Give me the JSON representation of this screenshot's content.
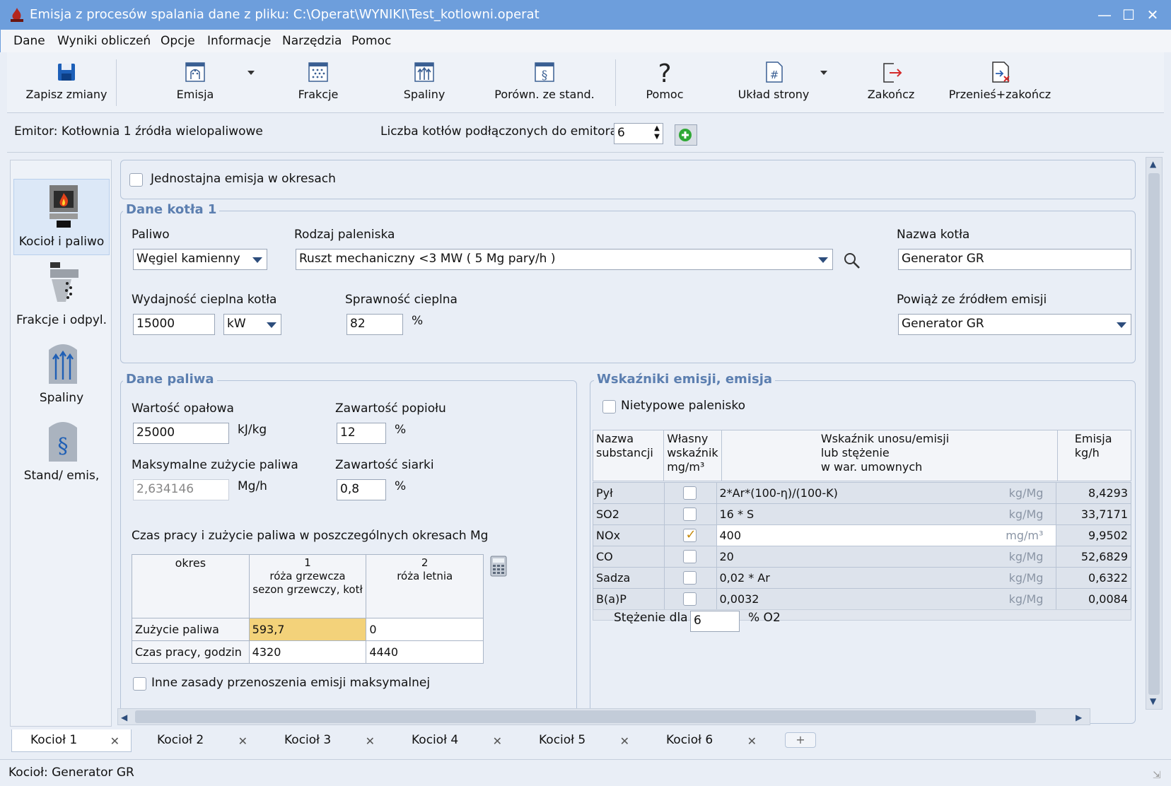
{
  "window": {
    "title": "Emisja z procesów spalania   dane z pliku: C:\\Operat\\WYNIKI\\Test_kotlowni.operat"
  },
  "menu": [
    "Dane",
    "Wyniki obliczeń",
    "Opcje",
    "Informacje",
    "Narzędzia",
    "Pomoc"
  ],
  "toolbar": {
    "save": "Zapisz zmiany",
    "emisja": "Emisja",
    "frakcje": "Frakcje",
    "spaliny": "Spaliny",
    "porown": "Porówn. ze stand.",
    "pomoc": "Pomoc",
    "uklad": "Układ strony",
    "zakoncz": "Zakończ",
    "przenies": "Przenieś+zakończ"
  },
  "emitter": {
    "label": "Emitor: Kotłownia 1 źródła wielopaliwowe",
    "boilers_label": "Liczba kotłów podłączonych do emitora",
    "boilers_value": "6"
  },
  "nav": [
    "Kocioł i paliwo",
    "Frakcje i odpyl.",
    "Spaliny",
    "Stand/ emis,"
  ],
  "uniform_emission": "Jednostajna emisja w okresach",
  "boiler": {
    "group_title": "Dane kotła 1",
    "fuel_label": "Paliwo",
    "fuel_value": "Węgiel kamienny",
    "furnace_label": "Rodzaj paleniska",
    "furnace_value": "Ruszt mechaniczny <3 MW ( 5 Mg pary/h )",
    "name_label": "Nazwa kotła",
    "name_value": "Generator GR",
    "capacity_label": "Wydajność cieplna kotła",
    "capacity_value": "15000",
    "capacity_unit": "kW",
    "efficiency_label": "Sprawność cieplna",
    "efficiency_value": "82",
    "efficiency_unit": "%",
    "link_label": "Powiąż ze źródłem emisji",
    "link_value": "Generator GR"
  },
  "fuel": {
    "group_title": "Dane paliwa",
    "calorific_label": "Wartość opałowa",
    "calorific_value": "25000",
    "calorific_unit": "kJ/kg",
    "ash_label": "Zawartość popiołu",
    "ash_value": "12",
    "ash_unit": "%",
    "max_use_label": "Maksymalne zużycie paliwa",
    "max_use_value": "2,634146",
    "max_use_unit": "Mg/h",
    "sulfur_label": "Zawartość siarki",
    "sulfur_value": "0,8",
    "sulfur_unit": "%",
    "periods_label": "Czas pracy i zużycie paliwa w poszczególnych okresach Mg",
    "periods_header": {
      "okres": "okres",
      "p1": [
        "1",
        "róża grzewcza",
        "sezon grzewczy, kotł"
      ],
      "p2": [
        "2",
        "róża letnia"
      ]
    },
    "rows": [
      {
        "name": "Zużycie paliwa",
        "v1": "593,7",
        "v2": "0"
      },
      {
        "name": "Czas pracy, godzin",
        "v1": "4320",
        "v2": "4440"
      }
    ],
    "other_rules": "Inne zasady przenoszenia emisji maksymalnej"
  },
  "emission": {
    "group_title": "Wskaźniki emisji, emisja",
    "atypical": "Nietypowe palenisko",
    "headers": {
      "substance": [
        "Nazwa",
        "substancji"
      ],
      "own": [
        "Własny",
        "wskaźnik",
        "mg/m³"
      ],
      "factor": [
        "Wskaźnik unosu/emisji",
        "lub stężenie",
        "w war. umownych"
      ],
      "emission": [
        "Emisja",
        "kg/h"
      ]
    },
    "rows": [
      {
        "name": "Pył",
        "own": false,
        "factor": "2*Ar*(100-η)/(100-K)",
        "unit": "kg/Mg",
        "value": "8,4293"
      },
      {
        "name": "SO2",
        "own": false,
        "factor": "16 * S",
        "unit": "kg/Mg",
        "value": "33,7171"
      },
      {
        "name": "NOx",
        "own": true,
        "factor": "400",
        "unit": "mg/m³",
        "value": "9,9502"
      },
      {
        "name": "CO",
        "own": false,
        "factor": "20",
        "unit": "kg/Mg",
        "value": "52,6829"
      },
      {
        "name": "Sadza",
        "own": false,
        "factor": "0,02 * Ar",
        "unit": "kg/Mg",
        "value": "0,6322"
      },
      {
        "name": "B(a)P",
        "own": false,
        "factor": "0,0032",
        "unit": "kg/Mg",
        "value": "0,0084"
      }
    ],
    "conc_label": "Stężenie dla",
    "conc_value": "6",
    "conc_unit": "% O2"
  },
  "tabs": [
    "Kocioł 1",
    "Kocioł 2",
    "Kocioł 3",
    "Kocioł 4",
    "Kocioł 5",
    "Kocioł 6"
  ],
  "status": "Kocioł: Generator GR"
}
